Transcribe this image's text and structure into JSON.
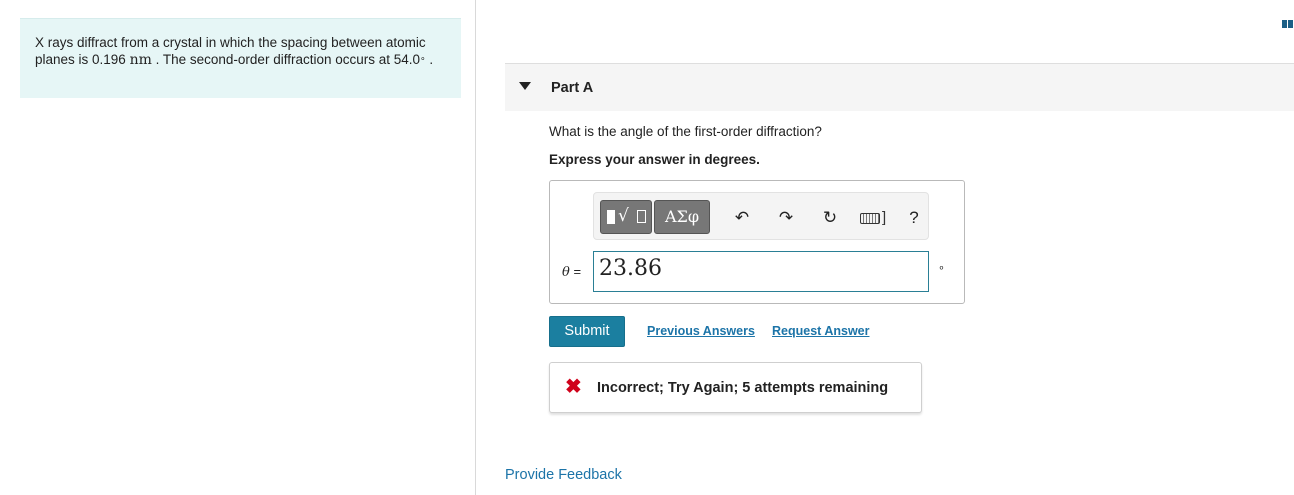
{
  "problem": {
    "text_1": "X rays diffract from a crystal in which the spacing between atomic planes is 0.196 ",
    "unit_nm": "nm",
    "text_2": " . The second-order diffraction occurs at 54.0",
    "degree": "∘",
    "text_3": " ."
  },
  "part": {
    "title": "Part A",
    "question": "What is the angle of the first-order diffraction?",
    "instruction": "Express your answer in degrees."
  },
  "toolbar": {
    "symbols_label": "ΑΣφ",
    "undo_glyph": "↶",
    "redo_glyph": "↷",
    "reset_glyph": "↻",
    "help_label": "?",
    "keyboard_bracket": "]"
  },
  "answer": {
    "variable": "θ",
    "equals": " =",
    "value": "23.86",
    "unit": "∘"
  },
  "actions": {
    "submit": "Submit",
    "previous_answers": "Previous Answers",
    "request_answer": "Request Answer"
  },
  "feedback": {
    "icon_glyph": "✖",
    "message": "Incorrect; Try Again; 5 attempts remaining"
  },
  "footer": {
    "provide_feedback": "Provide Feedback"
  },
  "colors": {
    "accent": "#1b7fa0",
    "link": "#1c74a8",
    "error": "#d0021b",
    "problem_bg": "#e6f6f6"
  },
  "icons": {
    "templates": "templates-icon",
    "symbols": "greek-symbols-icon",
    "undo": "undo-icon",
    "redo": "redo-icon",
    "reset": "reset-icon",
    "keyboard": "keyboard-icon",
    "help": "help-icon",
    "caret": "caret-down-icon",
    "incorrect": "incorrect-x-icon"
  }
}
